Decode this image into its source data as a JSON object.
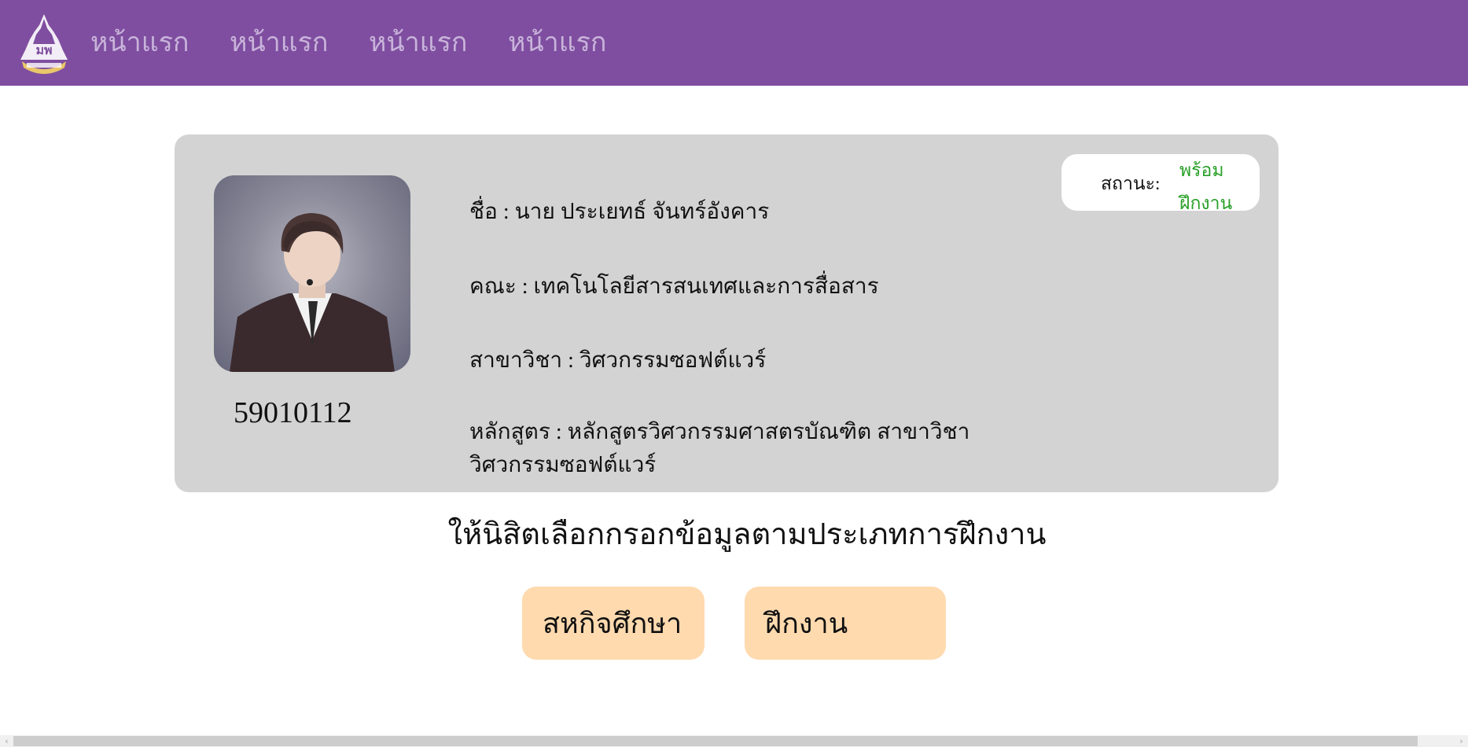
{
  "nav": {
    "items": [
      {
        "label": "หน้าแรก",
        "active": true
      },
      {
        "label": "หน้าแรก",
        "active": false
      },
      {
        "label": "หน้าแรก",
        "active": false
      },
      {
        "label": "หน้าแรก",
        "active": false
      }
    ]
  },
  "profile": {
    "student_id": "59010112",
    "name_line": "ชื่อ : นาย ประเยทธ์ จันทร์อังคาร",
    "faculty_line": "คณะ : เทคโนโลยีสารสนเทศและการสื่อสาร",
    "major_line": "สาขาวิชา : วิศวกรรมซอฟต์แวร์",
    "program_line": "หลักสูตร : หลักสูตรวิศวกรรมศาสตรบัณฑิต สาขาวิชา วิศวกรรมซอฟต์แวร์"
  },
  "status": {
    "label": "สถานะ:",
    "value": "พร้อมฝึกงาน"
  },
  "instruction": "ให้นิสิตเลือกกรอกข้อมูลตามประเภทการฝึกงาน",
  "choices": {
    "coop_label": "สหกิจศึกษา",
    "internship_label": "ฝึกงาน"
  },
  "colors": {
    "navbar": "#7f4ea0",
    "card": "#d3d3d3",
    "status_ok": "#28a028",
    "choice_button": "#ffdaaf"
  },
  "icons": {
    "logo": "university-emblem-icon",
    "scroll_left": "chevron-left-icon",
    "scroll_right": "chevron-right-icon"
  }
}
